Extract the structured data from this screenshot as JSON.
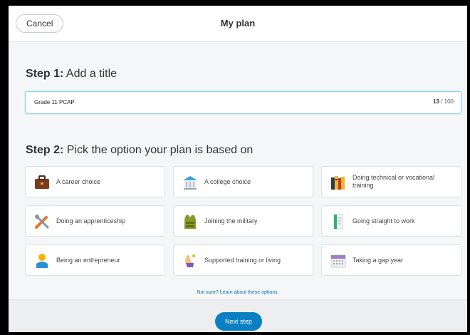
{
  "header": {
    "cancel_label": "Cancel",
    "title": "My plan"
  },
  "step1": {
    "prefix": "Step 1:",
    "text": "Add a title",
    "input_value": "Grade 11 PCAP",
    "count_current": "13",
    "count_sep": " / 100"
  },
  "step2": {
    "prefix": "Step 2:",
    "text": "Pick the option your plan is based on",
    "options": [
      {
        "label": "A career choice",
        "icon": "briefcase-icon"
      },
      {
        "label": "A college choice",
        "icon": "college-building-icon"
      },
      {
        "label": "Doing technical or vocational training",
        "icon": "books-icon"
      },
      {
        "label": "Doing an apprenticeship",
        "icon": "tools-icon"
      },
      {
        "label": "Joining the military",
        "icon": "military-vest-icon"
      },
      {
        "label": "Going straight to work",
        "icon": "checklist-icon"
      },
      {
        "label": "Being an entrepreneur",
        "icon": "entrepreneur-icon"
      },
      {
        "label": "Supported training or living",
        "icon": "helping-hand-icon"
      },
      {
        "label": "Taking a gap year",
        "icon": "calendar-icon"
      }
    ],
    "learn_link": "Not sure? Learn about these options."
  },
  "footer": {
    "next_label": "Next step"
  },
  "colors": {
    "accent": "#0b7fc4",
    "link": "#0b76b8",
    "input_focus": "#8fd0e8"
  }
}
